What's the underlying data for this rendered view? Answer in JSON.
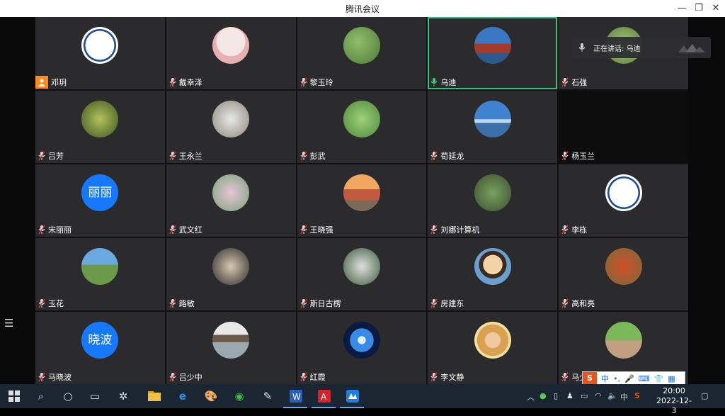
{
  "window": {
    "title": "腾讯会议"
  },
  "speaking": {
    "label": "正在讲话: 乌迪"
  },
  "participants": [
    {
      "name": "邓玥",
      "host": true
    },
    {
      "name": "戴幸泽"
    },
    {
      "name": "黎玉玲"
    },
    {
      "name": "乌迪",
      "active": true
    },
    {
      "name": "石强"
    },
    {
      "name": "吕芳"
    },
    {
      "name": "王永兰"
    },
    {
      "name": "彭武"
    },
    {
      "name": "荀延龙"
    },
    {
      "name": "杨玉兰",
      "dark": true
    },
    {
      "name": "宋丽丽",
      "avatar_text": "丽丽"
    },
    {
      "name": "武文红"
    },
    {
      "name": "王晓强"
    },
    {
      "name": "刘娜计算机"
    },
    {
      "name": "李栋"
    },
    {
      "name": "玉花"
    },
    {
      "name": "路敏"
    },
    {
      "name": "斯日古楞"
    },
    {
      "name": "房建东"
    },
    {
      "name": "高和亮"
    },
    {
      "name": "马晓波",
      "avatar_text": "晓波"
    },
    {
      "name": "吕少中"
    },
    {
      "name": "红霞"
    },
    {
      "name": "李文静"
    },
    {
      "name": "马少"
    }
  ],
  "ime": {
    "lang": "中"
  },
  "taskbar": {
    "time": "20:00",
    "date": "2022-12-3",
    "ime_lang": "中"
  },
  "colors": {
    "accent": "#30c27a",
    "host_badge": "#ff8a1f",
    "text_avatar": "#1677ff"
  }
}
